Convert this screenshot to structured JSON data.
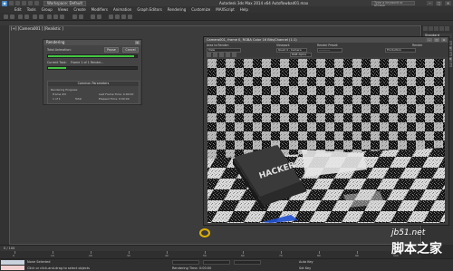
{
  "titlebar": {
    "workspace": "Workspace: Default",
    "title": "Autodesk 3ds Max  2014 x64    Autoflowbad01.max",
    "search_placeholder": "Type a keyword or phrase",
    "minimize": "–",
    "maximize": "□",
    "close": "×"
  },
  "menu": [
    "Edit",
    "Tools",
    "Group",
    "Views",
    "Create",
    "Modifiers",
    "Animation",
    "Graph Editors",
    "Rendering",
    "Customize",
    "MAXScript",
    "Help"
  ],
  "viewport": {
    "label": "[+] [Camera001 ] [Realistic ]"
  },
  "command_panel": {
    "header": "Standard",
    "buttons": [
      "Box",
      "Cone",
      "Sphere",
      "GeoSphere",
      "Cylinder",
      "Tube",
      "Torus",
      "Pyramid",
      "Teapot",
      "Plane"
    ]
  },
  "render_dialog": {
    "title": "Rendering",
    "close": "×",
    "total_animation_label": "Total Animation:",
    "pause_label": "Pause",
    "cancel_label": "Cancel",
    "total_progress": 0.97,
    "current_task_label": "Current Task:",
    "current_task_value": "Frame 1 of 1   Render...",
    "task_progress": 0.2,
    "section_title": "Common Parameters",
    "progress_title": "Rendering Progress:",
    "frame_label": "Frame #",
    "frame_value": "0",
    "of_label": "1 of 1",
    "total_label": "Total",
    "last_frame_time": "Last Frame Time: 0:00:00",
    "elapsed_time": "Elapsed Time: 0:00:00"
  },
  "frame_buffer": {
    "title": "Camera001, frame 0, RGBA Color 16 Bits/Channel (1:1)",
    "area_label": "Area to Render:",
    "area_value": "View",
    "viewport_label": "Viewport:",
    "viewport_value": "Quad 4 - Camera",
    "preset_label": "Render Preset:",
    "preset_value": "-----------",
    "production_value": "Production",
    "render_button": "Render",
    "channel_value": "RGB Alpha",
    "minimize": "–",
    "maximize": "□",
    "close": "×"
  },
  "timeline": {
    "slider": "0 / 100",
    "ticks": [
      "0",
      "10",
      "20",
      "30",
      "40",
      "50",
      "60",
      "70",
      "80",
      "90",
      "100"
    ]
  },
  "status": {
    "selected": "None Selected",
    "prompt": "Click or click-and-drag to select objects",
    "rendering_time": "Rendering Time: 0:00:00",
    "auto_key": "Auto Key",
    "set_key": "Set Key"
  },
  "watermark": {
    "url": "jb51.net",
    "site_name": "脚本之家"
  },
  "colors": {
    "progress_green": "#44c544",
    "checker_light": "#dcdcdc",
    "checker_dark": "#141414"
  }
}
